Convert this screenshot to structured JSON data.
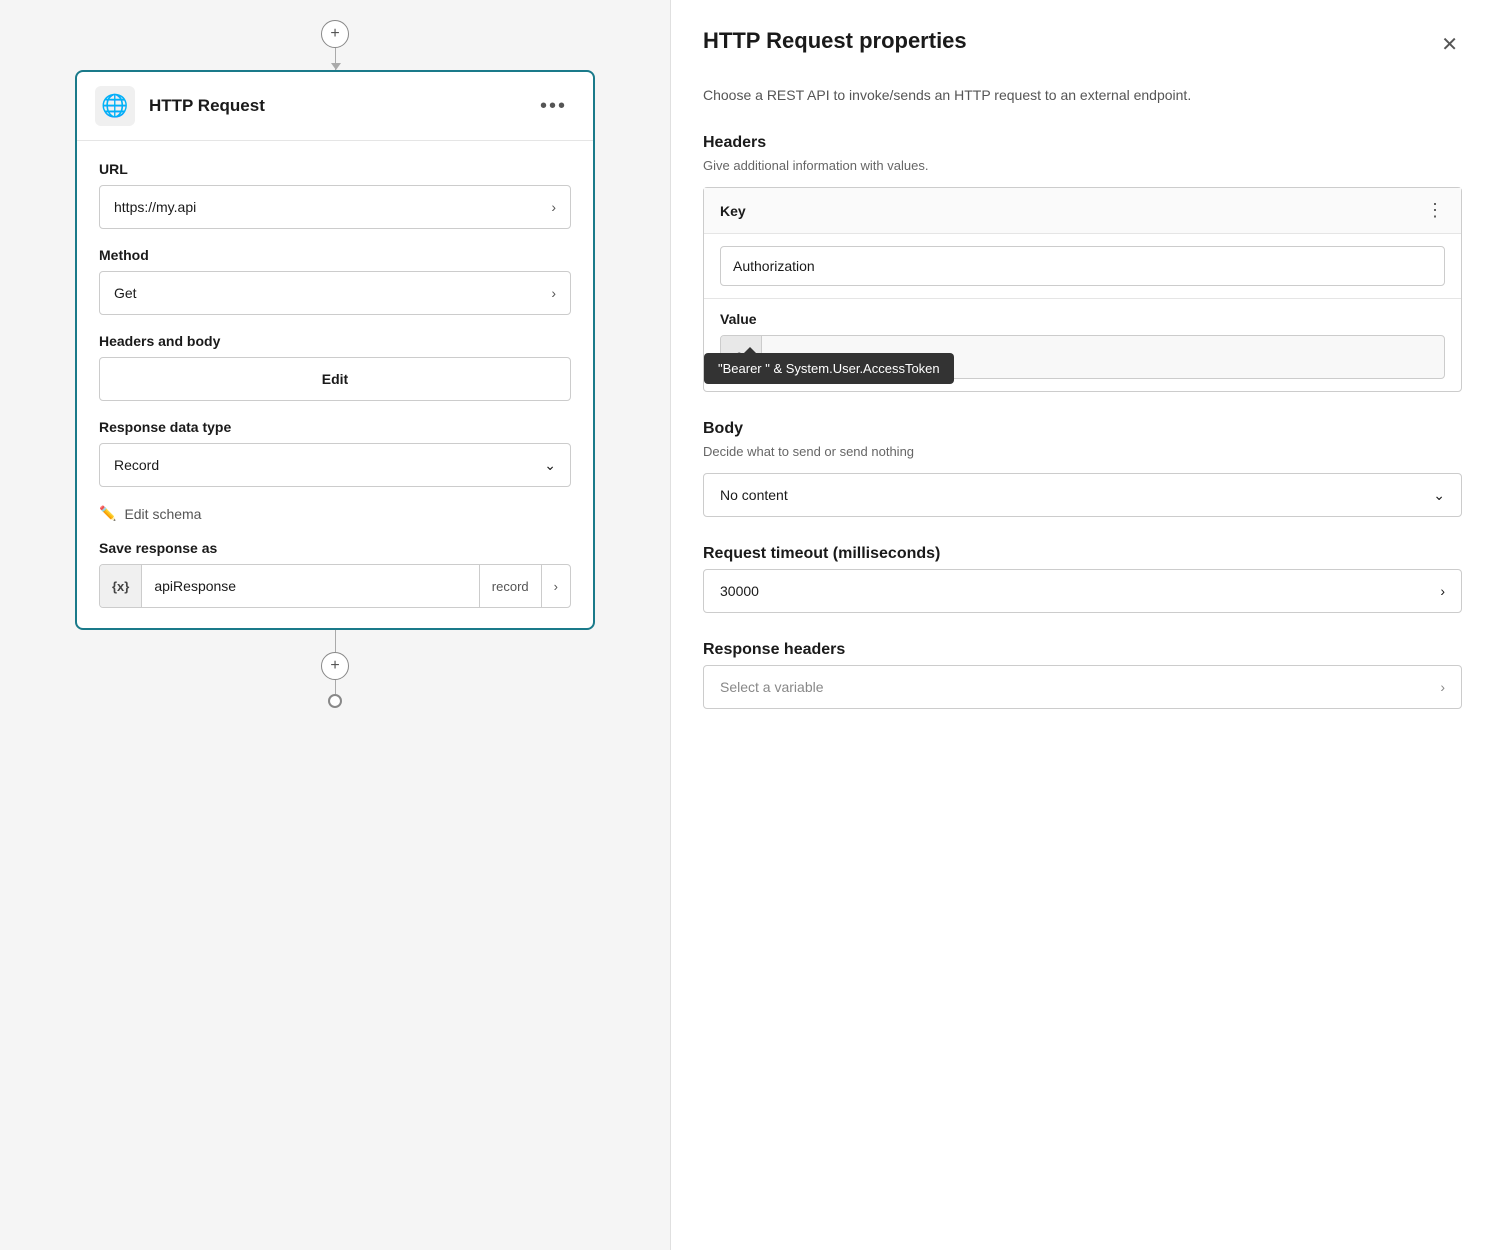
{
  "left": {
    "addButton": "+",
    "card": {
      "title": "HTTP Request",
      "moreBtn": "•••",
      "fields": {
        "urlLabel": "URL",
        "urlValue": "https://my.api",
        "methodLabel": "Method",
        "methodValue": "Get",
        "headersBodyLabel": "Headers and body",
        "editBtn": "Edit",
        "responseDataTypeLabel": "Response data type",
        "responseDataTypeValue": "Record",
        "editSchemaLabel": "Edit schema",
        "saveResponseLabel": "Save response as",
        "saveTag": "{x}",
        "saveName": "apiResponse",
        "saveType": "record"
      }
    }
  },
  "right": {
    "title": "HTTP Request properties",
    "closeBtn": "✕",
    "description": "Choose a REST API to invoke/sends an HTTP request to an external endpoint.",
    "headers": {
      "sectionTitle": "Headers",
      "sectionDesc": "Give additional information with values.",
      "tableHeader": "Key",
      "keyValue": "Authorization",
      "valueLabel": "Value",
      "fxBadge": "fx",
      "fxValue": "\"Bearer \" & System.User.Ac...",
      "tooltipText": "\"Bearer \" & System.User.AccessToken"
    },
    "body": {
      "sectionTitle": "Body",
      "sectionDesc": "Decide what to send or send nothing",
      "value": "No content"
    },
    "timeout": {
      "sectionTitle": "Request timeout (milliseconds)",
      "value": "30000"
    },
    "responseHeaders": {
      "sectionTitle": "Response headers",
      "placeholder": "Select a variable"
    }
  }
}
